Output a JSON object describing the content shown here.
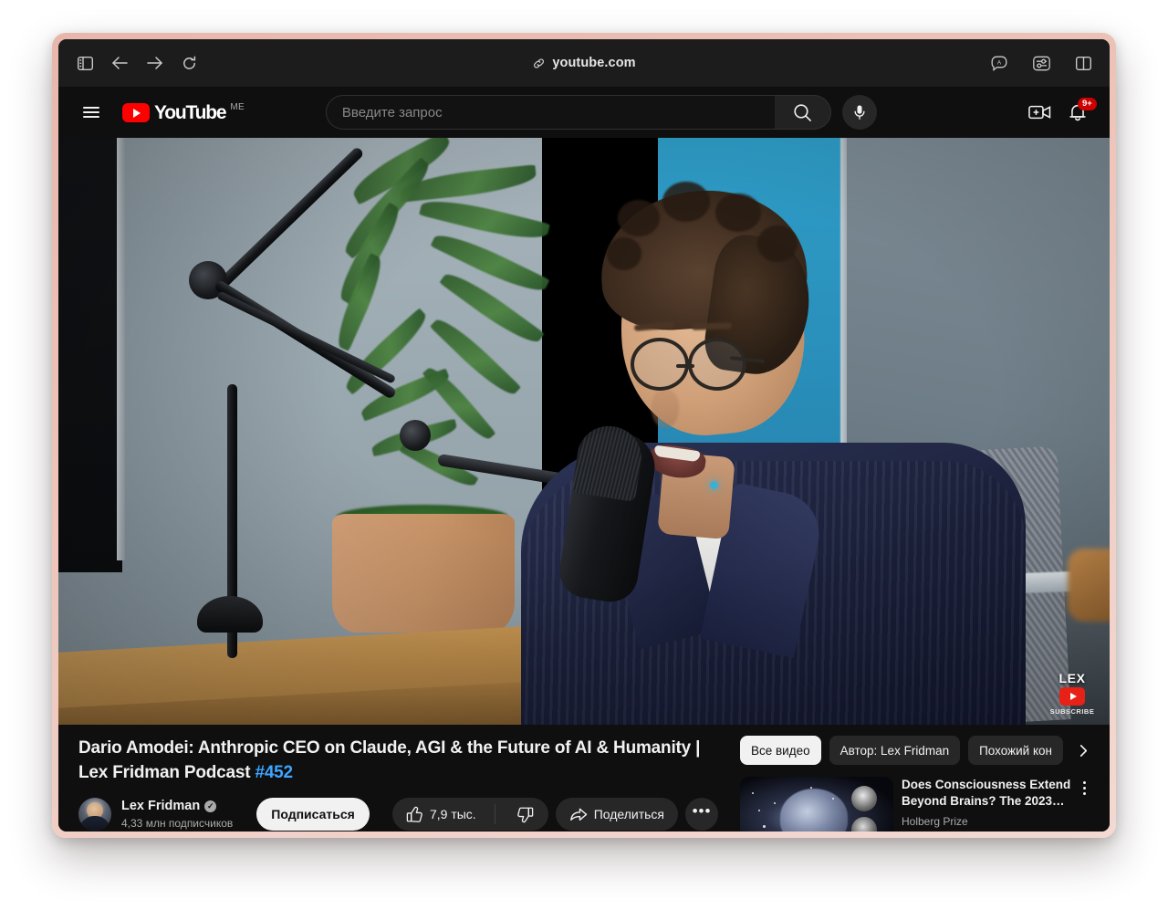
{
  "browser": {
    "url": "youtube.com",
    "url_icon": "link-icon",
    "toolbar_left": [
      {
        "name": "sidebar-toggle-icon",
        "label": "Sidebar"
      },
      {
        "name": "back-icon",
        "label": "Back"
      },
      {
        "name": "forward-icon",
        "label": "Forward"
      },
      {
        "name": "reload-icon",
        "label": "Reload"
      }
    ],
    "toolbar_right": [
      {
        "name": "translate-icon",
        "label": "Translate"
      },
      {
        "name": "page-settings-icon",
        "label": "Page Settings"
      },
      {
        "name": "split-view-icon",
        "label": "Split View"
      }
    ]
  },
  "yt_header": {
    "menu_label": "Menu",
    "logo_text": "YouTube",
    "logo_country": "ME",
    "search": {
      "value": "",
      "placeholder": "Введите запрос",
      "submit_label": "Поиск",
      "voice_label": "Голосовой поиск"
    },
    "create_label": "Создать",
    "notifications_label": "Уведомления",
    "notifications_badge": "9+"
  },
  "player": {
    "watermark_brand": "LEX",
    "watermark_cta": "SUBSCRIBE"
  },
  "video": {
    "title_main": "Dario Amodei: Anthropic CEO on Claude, AGI & the Future of AI & Humanity | Lex Fridman Podcast ",
    "title_hash": "#452",
    "channel": {
      "name": "Lex Fridman",
      "verified_glyph": "✓",
      "subscribers": "4,33 млн подписчиков",
      "subscribe_label": "Подписаться"
    },
    "actions": {
      "like_count": "7,9 тыс.",
      "like_label": "Нравится",
      "dislike_label": "Не нравится",
      "share_label": "Поделиться",
      "more_label": "Ещё",
      "more_glyph": "•••"
    }
  },
  "sidebar": {
    "chips": [
      {
        "label": "Все видео",
        "active": true
      },
      {
        "label": "Автор: Lex Fridman",
        "active": false
      },
      {
        "label": "Похожий кон",
        "active": false
      }
    ],
    "next_label": "Далее",
    "recommendations": [
      {
        "title": "Does Consciousness Extend Beyond Brains? The 2023…",
        "channel": "Holberg Prize",
        "menu_label": "Действия"
      }
    ]
  },
  "colors": {
    "brand_red": "#ff0000",
    "link_blue": "#3ea6ff",
    "badge_red": "#cc0000",
    "surface": "#0f0f0f",
    "chip": "#272727",
    "frame": "#edc3b7"
  }
}
